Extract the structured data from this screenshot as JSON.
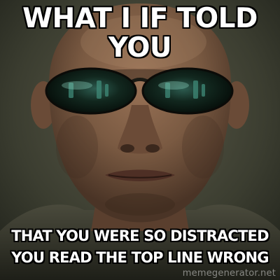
{
  "meme": {
    "top_lines": [
      "WHAT I IF TOLD",
      "YOU"
    ],
    "bottom_lines": [
      "THAT YOU WERE SO DISTRACTED",
      "YOU READ THE TOP LINE WRONG"
    ],
    "watermark": "memegenerator.net"
  },
  "colors": {
    "caption_fill": "#ffffff",
    "caption_outline": "#000000",
    "background": "#3a3a30",
    "skin": "#7a5a42",
    "lens": "#0c1a12",
    "lens_reflection": "#2f7a6a"
  }
}
